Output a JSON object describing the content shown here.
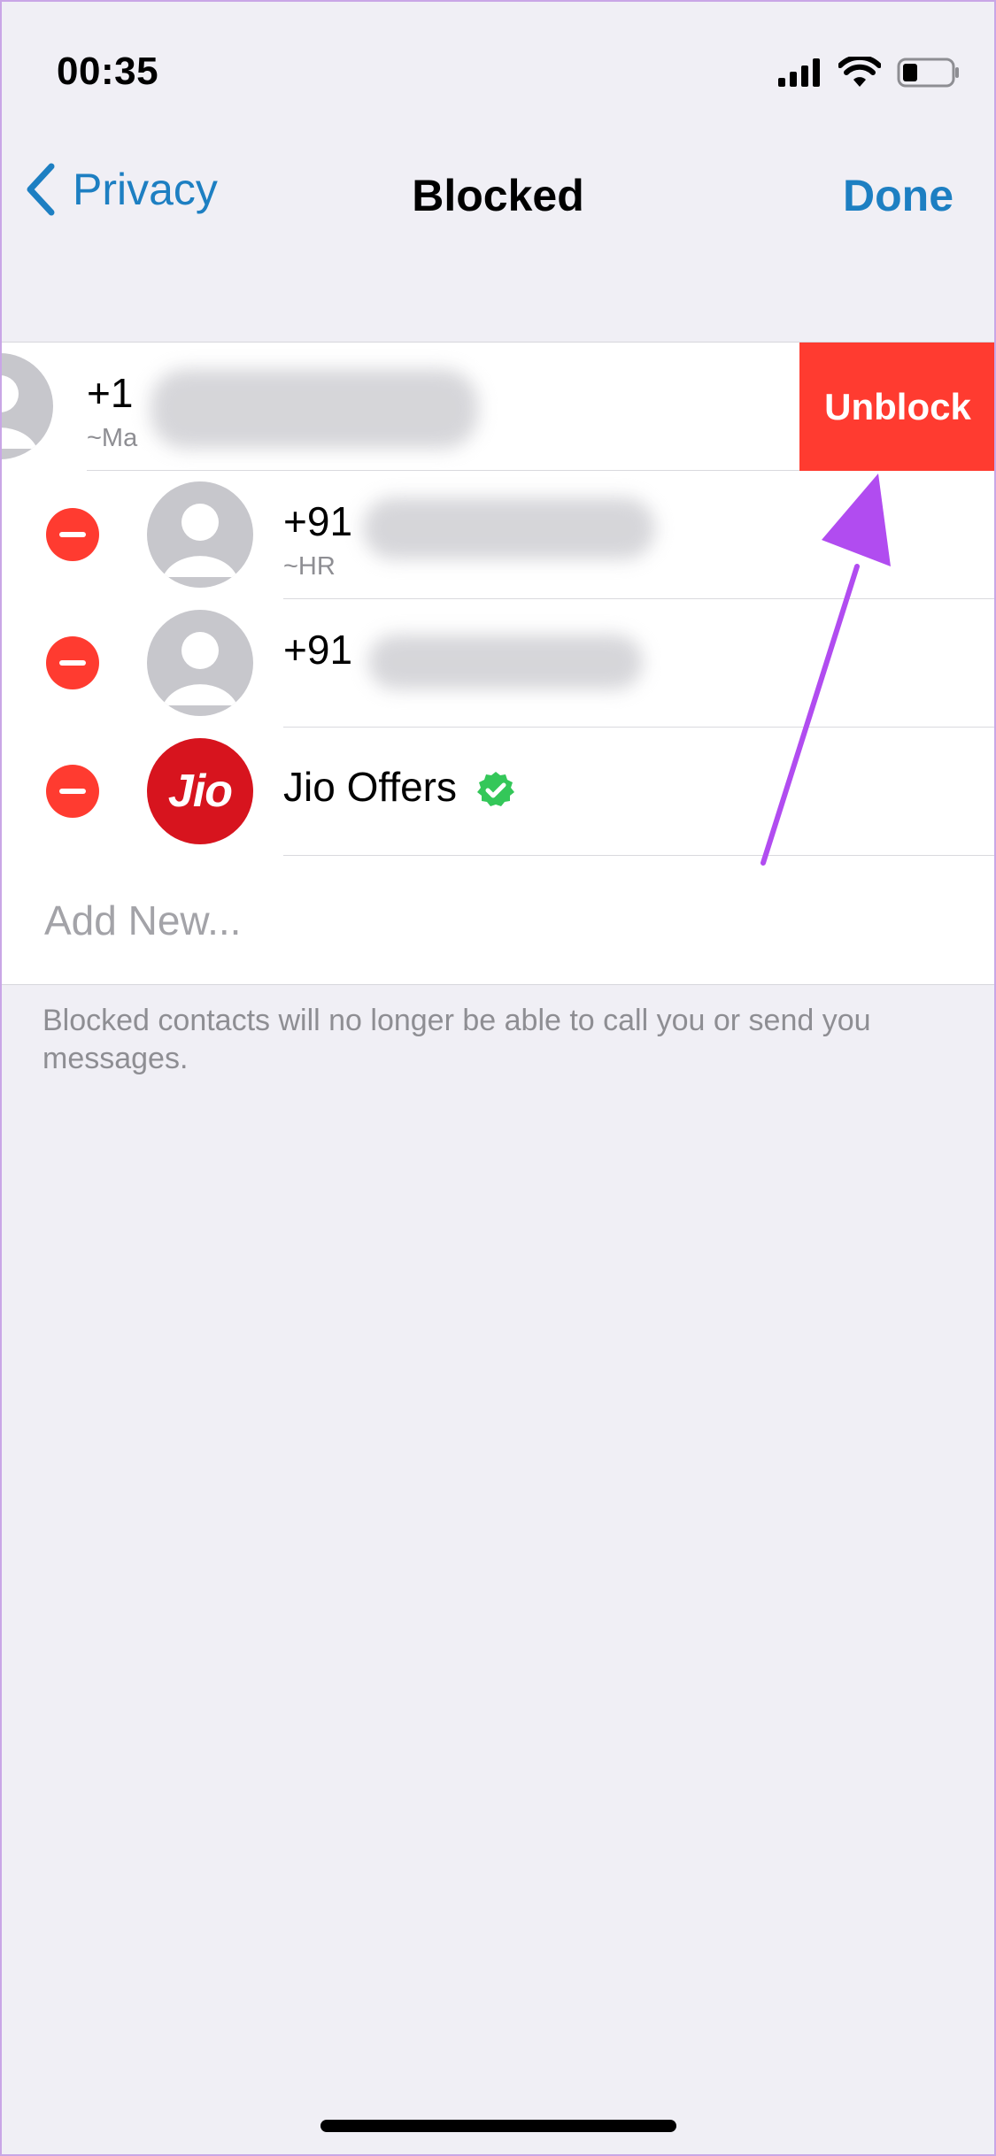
{
  "status": {
    "time": "00:35"
  },
  "nav": {
    "back_label": "Privacy",
    "title": "Blocked",
    "done_label": "Done"
  },
  "blocked": {
    "rows": [
      {
        "number": "+1",
        "subtitle": "~Ma"
      },
      {
        "number": "+91",
        "subtitle": "~HR"
      },
      {
        "number": "+91",
        "subtitle": ""
      },
      {
        "name": "Jio Offers",
        "logo_text": "Jio"
      }
    ],
    "unblock_label": "Unblock",
    "add_new_label": "Add New..."
  },
  "footer": {
    "note": "Blocked contacts will no longer be able to call you or send you messages."
  },
  "colors": {
    "accent": "#1d7fc2",
    "destructive": "#ff3b30",
    "verified": "#34c759",
    "annotation_arrow": "#b14cf0"
  }
}
